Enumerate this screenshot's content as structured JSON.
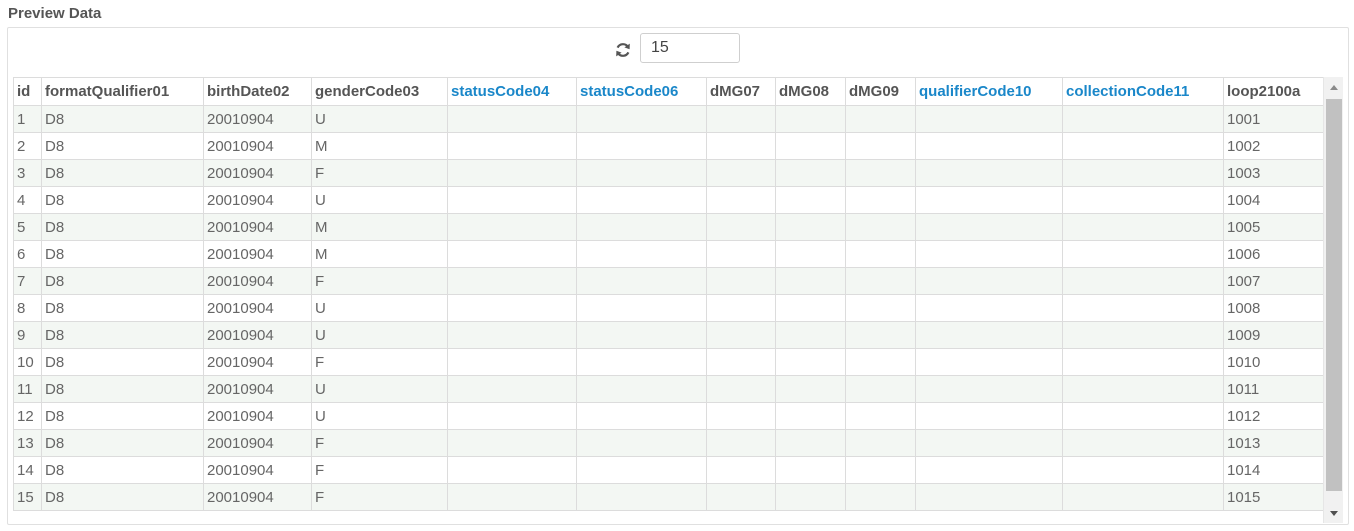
{
  "panel": {
    "title": "Preview Data"
  },
  "controls": {
    "rows_value": "15",
    "refresh_icon": "refresh-icon"
  },
  "colors": {
    "highlight_header": "#1a87c9",
    "odd_row": "#f3f7f3",
    "border": "#dcdcdc"
  },
  "columns": [
    {
      "label": "id",
      "highlight": false
    },
    {
      "label": "formatQualifier01",
      "highlight": false
    },
    {
      "label": "birthDate02",
      "highlight": false
    },
    {
      "label": "genderCode03",
      "highlight": false
    },
    {
      "label": "statusCode04",
      "highlight": true
    },
    {
      "label": "statusCode06",
      "highlight": true
    },
    {
      "label": "dMG07",
      "highlight": false
    },
    {
      "label": "dMG08",
      "highlight": false
    },
    {
      "label": "dMG09",
      "highlight": false
    },
    {
      "label": "qualifierCode10",
      "highlight": true
    },
    {
      "label": "collectionCode11",
      "highlight": true
    },
    {
      "label": "loop2100a",
      "highlight": false
    }
  ],
  "rows": [
    [
      "1",
      "D8",
      "20010904",
      "U",
      "",
      "",
      "",
      "",
      "",
      "",
      "",
      "1001"
    ],
    [
      "2",
      "D8",
      "20010904",
      "M",
      "",
      "",
      "",
      "",
      "",
      "",
      "",
      "1002"
    ],
    [
      "3",
      "D8",
      "20010904",
      "F",
      "",
      "",
      "",
      "",
      "",
      "",
      "",
      "1003"
    ],
    [
      "4",
      "D8",
      "20010904",
      "U",
      "",
      "",
      "",
      "",
      "",
      "",
      "",
      "1004"
    ],
    [
      "5",
      "D8",
      "20010904",
      "M",
      "",
      "",
      "",
      "",
      "",
      "",
      "",
      "1005"
    ],
    [
      "6",
      "D8",
      "20010904",
      "M",
      "",
      "",
      "",
      "",
      "",
      "",
      "",
      "1006"
    ],
    [
      "7",
      "D8",
      "20010904",
      "F",
      "",
      "",
      "",
      "",
      "",
      "",
      "",
      "1007"
    ],
    [
      "8",
      "D8",
      "20010904",
      "U",
      "",
      "",
      "",
      "",
      "",
      "",
      "",
      "1008"
    ],
    [
      "9",
      "D8",
      "20010904",
      "U",
      "",
      "",
      "",
      "",
      "",
      "",
      "",
      "1009"
    ],
    [
      "10",
      "D8",
      "20010904",
      "F",
      "",
      "",
      "",
      "",
      "",
      "",
      "",
      "1010"
    ],
    [
      "11",
      "D8",
      "20010904",
      "U",
      "",
      "",
      "",
      "",
      "",
      "",
      "",
      "1011"
    ],
    [
      "12",
      "D8",
      "20010904",
      "U",
      "",
      "",
      "",
      "",
      "",
      "",
      "",
      "1012"
    ],
    [
      "13",
      "D8",
      "20010904",
      "F",
      "",
      "",
      "",
      "",
      "",
      "",
      "",
      "1013"
    ],
    [
      "14",
      "D8",
      "20010904",
      "F",
      "",
      "",
      "",
      "",
      "",
      "",
      "",
      "1014"
    ],
    [
      "15",
      "D8",
      "20010904",
      "F",
      "",
      "",
      "",
      "",
      "",
      "",
      "",
      "1015"
    ]
  ]
}
